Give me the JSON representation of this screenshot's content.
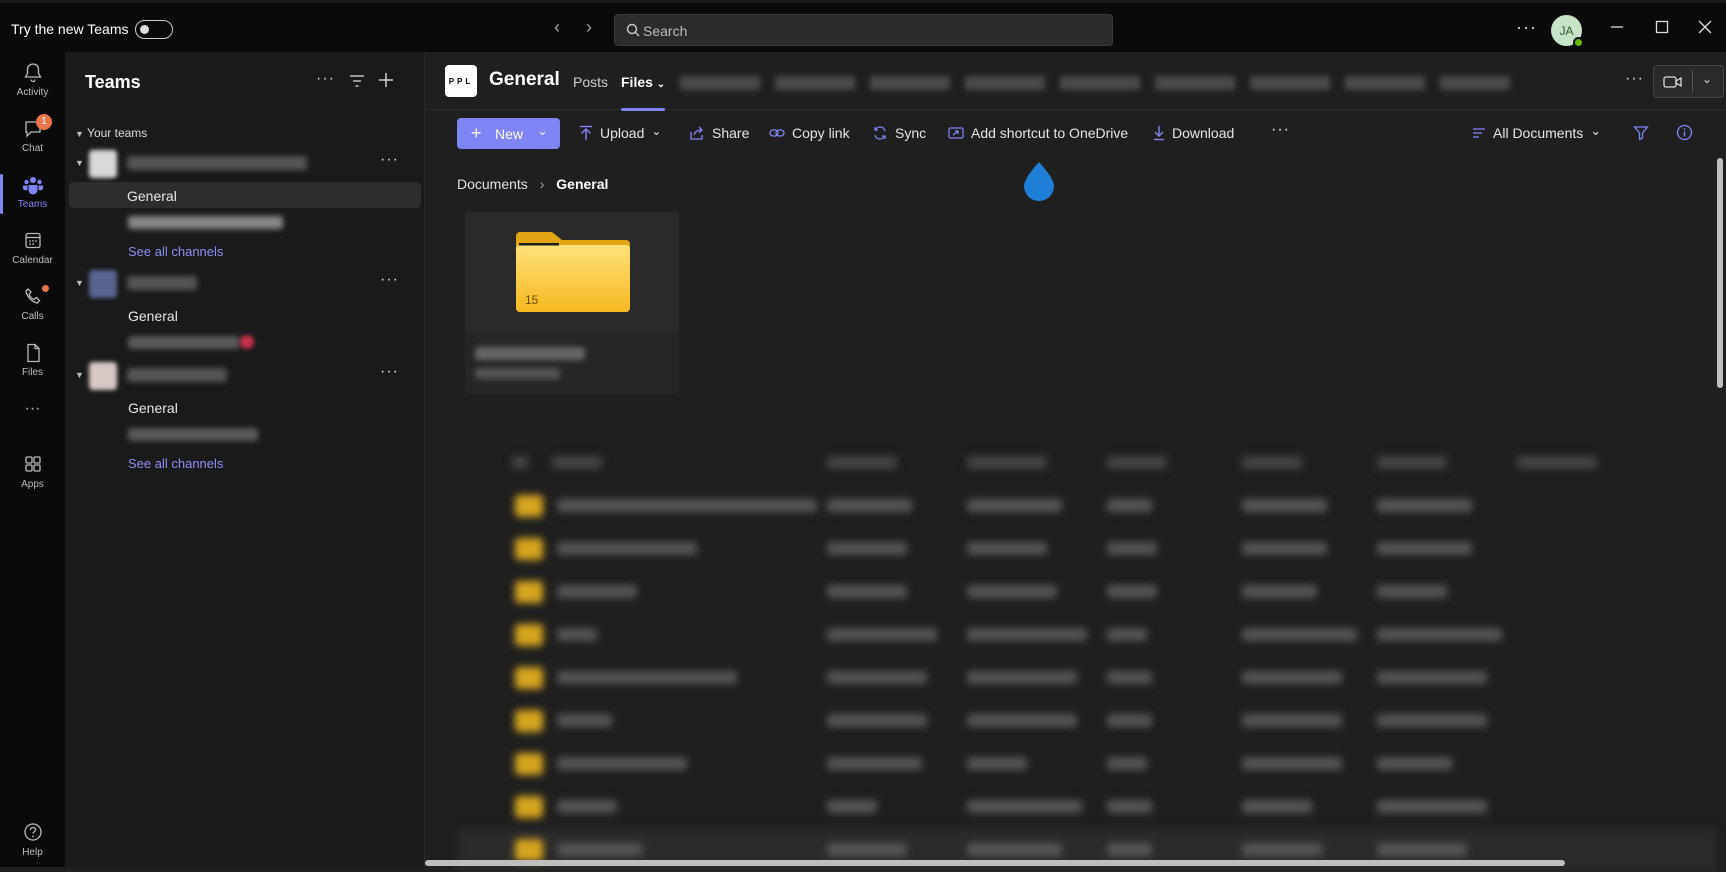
{
  "titlebar": {
    "try_label": "Try the new Teams",
    "search_placeholder": "Search",
    "avatar_initials": "JA",
    "more": "···"
  },
  "rail": {
    "items": [
      {
        "label": "Activity",
        "icon": "bell-icon"
      },
      {
        "label": "Chat",
        "icon": "chat-icon",
        "badge": "1"
      },
      {
        "label": "Teams",
        "icon": "teams-icon",
        "active": true
      },
      {
        "label": "Calendar",
        "icon": "calendar-icon"
      },
      {
        "label": "Calls",
        "icon": "phone-icon"
      },
      {
        "label": "Files",
        "icon": "file-icon"
      },
      {
        "label": "···",
        "icon": "more-icon"
      },
      {
        "label": "Apps",
        "icon": "apps-icon"
      },
      {
        "label": "Help",
        "icon": "help-icon"
      }
    ]
  },
  "sidebar": {
    "title": "Teams",
    "section": "Your teams",
    "teams": [
      {
        "channels": [
          "General"
        ],
        "see_all": "See all channels"
      },
      {
        "channels": [
          "General"
        ]
      },
      {
        "channels": [
          "General"
        ],
        "see_all": "See all channels"
      }
    ]
  },
  "header": {
    "channel": "General",
    "logo_text": "PPL",
    "tabs": [
      "Posts",
      "Files"
    ],
    "active_tab": "Files"
  },
  "toolbar": {
    "new": "New",
    "upload": "Upload",
    "share": "Share",
    "copy_link": "Copy link",
    "sync": "Sync",
    "shortcut": "Add shortcut to OneDrive",
    "download": "Download",
    "more": "···",
    "view": "All Documents"
  },
  "breadcrumb": {
    "root": "Documents",
    "current": "General"
  },
  "folder_tile": {
    "count": "15"
  },
  "colors": {
    "accent": "#7f85f5",
    "folder": "#ffc83d",
    "badge": "#e97548"
  }
}
